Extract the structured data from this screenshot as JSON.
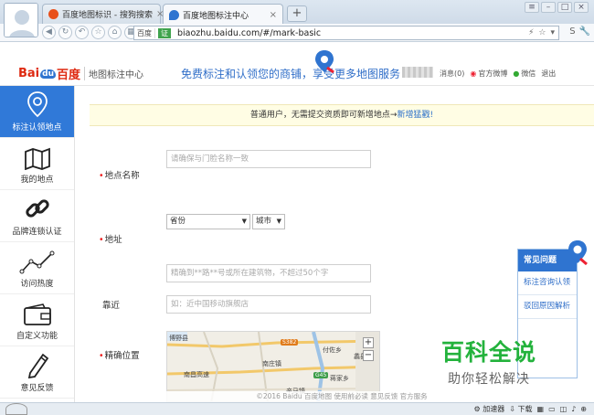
{
  "browser": {
    "tabs": [
      {
        "title": "百度地图标识 - 搜狗搜索",
        "active": false
      },
      {
        "title": "百度地图标注中心",
        "active": true
      }
    ],
    "new_tab": "+",
    "window_buttons": [
      "≡",
      "–",
      "□",
      "×"
    ],
    "address": {
      "domain_label": "百度",
      "verified_label": "证",
      "url": "biaozhu.baidu.com/#/mark-basic"
    },
    "status_bar": {
      "accelerator": "加速器",
      "download": "下载"
    }
  },
  "header": {
    "logo_bai": "Bai",
    "logo_du": "du",
    "logo_cn": "百度",
    "logo_sub": "地图标注中心",
    "slogan": "免费标注和认领您的商铺，享受更多地图服务",
    "links": [
      {
        "label": "消息(0)",
        "icon": "none"
      },
      {
        "label": "官方微博",
        "icon": "weibo-icon"
      },
      {
        "label": "微信",
        "icon": "wechat-icon"
      },
      {
        "label": "退出",
        "icon": "none"
      }
    ]
  },
  "sidebar": {
    "items": [
      {
        "label": "标注认领地点",
        "icon": "location-pin-icon",
        "active": true
      },
      {
        "label": "我的地点",
        "icon": "map-icon",
        "active": false
      },
      {
        "label": "品牌连锁认证",
        "icon": "chain-link-icon",
        "active": false
      },
      {
        "label": "访问热度",
        "icon": "line-trend-icon",
        "active": false
      },
      {
        "label": "自定义功能",
        "icon": "wallet-icon",
        "active": false
      },
      {
        "label": "意见反馈",
        "icon": "pencil-icon",
        "active": false
      }
    ]
  },
  "notice": {
    "text": "普通用户，无需提交资质即可新增地点→",
    "link": "新增猛戳!"
  },
  "form": {
    "name_label": "地点名称",
    "name_placeholder": "请确保与门脸名称一致",
    "address_label": "地址",
    "province_value": "省份",
    "city_value": "城市",
    "address_placeholder": "精确到**路**号或所在建筑物，不超过50个字",
    "nearby_label": "靠近",
    "nearby_placeholder": "如：近中国移动旗舰店",
    "position_label": "精确位置",
    "required_mark": "•"
  },
  "map": {
    "labels": [
      "博野县",
      "S382",
      "付佐乡",
      "蠡县",
      "南庄镇",
      "南昌高速",
      "G45",
      "蒋家乡",
      "辛马镇"
    ],
    "zoom_in": "+",
    "zoom_out": "−"
  },
  "faq": {
    "title": "常见问题",
    "items": [
      "标注咨询认领",
      "驳回原因解析"
    ]
  },
  "footer": {
    "text": "©2016 Baidu   百度地图   使用前必读   意见反馈   官方服务"
  },
  "watermark": {
    "big": "百科全说",
    "small": "助你轻松解决"
  },
  "colors": {
    "accent": "#3079d8",
    "required": "#e22222",
    "notice_bg": "#fffde4",
    "watermark_green": "#23b23c"
  }
}
